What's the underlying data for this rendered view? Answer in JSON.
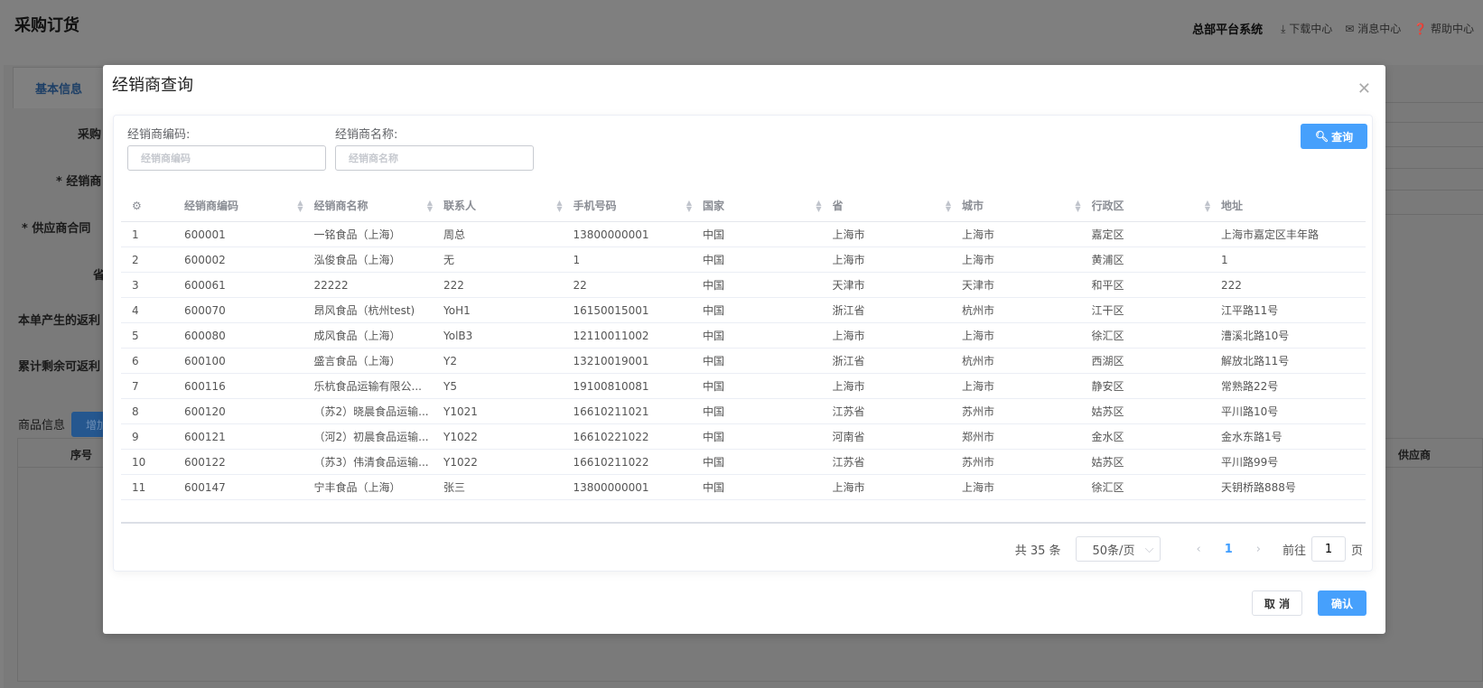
{
  "page": {
    "title": "采购订货",
    "system_name": "总部平台系统",
    "links": [
      {
        "icon": "download-icon",
        "label": "下载中心"
      },
      {
        "icon": "mail-icon",
        "label": "消息中心"
      },
      {
        "icon": "help-icon",
        "label": "帮助中心"
      }
    ]
  },
  "background": {
    "tab": "基本信息",
    "labels": [
      "采购",
      "* 经销商",
      "* 供应商合同",
      "省",
      "本单产生的返利",
      "累计剩余可返利"
    ],
    "goods_label": "商品信息",
    "add_button": "增加",
    "table_headers": [
      "序号",
      "供应商"
    ]
  },
  "modal": {
    "title": "经销商查询",
    "filters": [
      {
        "label": "经销商编码:",
        "placeholder": "经销商编码",
        "value": ""
      },
      {
        "label": "经销商名称:",
        "placeholder": "经销商名称",
        "value": ""
      }
    ],
    "query_button": "查询",
    "columns": [
      "经销商编码",
      "经销商名称",
      "联系人",
      "手机号码",
      "国家",
      "省",
      "城市",
      "行政区",
      "地址"
    ],
    "rows": [
      [
        "1",
        "600001",
        "一铭食品（上海）",
        "周总",
        "13800000001",
        "中国",
        "上海市",
        "上海市",
        "嘉定区",
        "上海市嘉定区丰年路"
      ],
      [
        "2",
        "600002",
        "泓俊食品（上海）",
        "无",
        "1",
        "中国",
        "上海市",
        "上海市",
        "黄浦区",
        "1"
      ],
      [
        "3",
        "600061",
        "22222",
        "222",
        "22",
        "中国",
        "天津市",
        "天津市",
        "和平区",
        "222"
      ],
      [
        "4",
        "600070",
        "昂风食品（杭州test)",
        "YoH1",
        "16150015001",
        "中国",
        "浙江省",
        "杭州市",
        "江干区",
        "江平路11号"
      ],
      [
        "5",
        "600080",
        "成风食品（上海）",
        "YolB3",
        "12110011002",
        "中国",
        "上海市",
        "上海市",
        "徐汇区",
        "漕溪北路10号"
      ],
      [
        "6",
        "600100",
        "盛言食品（上海）",
        "Y2",
        "13210019001",
        "中国",
        "浙江省",
        "杭州市",
        "西湖区",
        "解放北路11号"
      ],
      [
        "7",
        "600116",
        "乐杭食品运输有限公...",
        "Y5",
        "19100810081",
        "中国",
        "上海市",
        "上海市",
        "静安区",
        "常熟路22号"
      ],
      [
        "8",
        "600120",
        "（苏2）晓晨食品运输...",
        "Y1021",
        "16610211021",
        "中国",
        "江苏省",
        "苏州市",
        "姑苏区",
        "平川路10号"
      ],
      [
        "9",
        "600121",
        "（河2）初晨食品运输...",
        "Y1022",
        "16610221022",
        "中国",
        "河南省",
        "郑州市",
        "金水区",
        "金水东路1号"
      ],
      [
        "10",
        "600122",
        "（苏3）伟清食品运输...",
        "Y1022",
        "16610211022",
        "中国",
        "江苏省",
        "苏州市",
        "姑苏区",
        "平川路99号"
      ],
      [
        "11",
        "600147",
        "宁丰食品（上海）",
        "张三",
        "13800000001",
        "中国",
        "上海市",
        "上海市",
        "徐汇区",
        "天钥桥路888号"
      ]
    ],
    "pagination": {
      "total": "共 35 条",
      "page_size": "50条/页",
      "current": "1",
      "goto_label": "前往",
      "goto_value": "1",
      "page_suffix": "页"
    },
    "cancel": "取 消",
    "confirm": "确认"
  }
}
